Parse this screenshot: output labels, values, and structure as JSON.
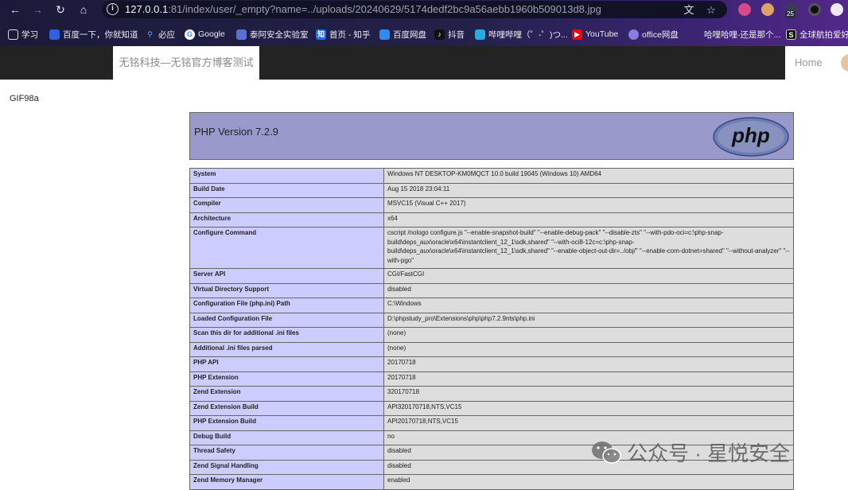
{
  "browser": {
    "url_host": "127.0.0.1",
    "url_rest": ":81/index/user/_empty?name=../uploads/20240629/5174dedf2bc9a56aebb1960b509013d8.jpg",
    "ext_badge": "25",
    "bookmarks": [
      {
        "label": "学习",
        "icon": "folder-icon"
      },
      {
        "label": "百度一下，你就知道",
        "icon": "baidu-icon"
      },
      {
        "label": "必应",
        "icon": "bing-icon"
      },
      {
        "label": "Google",
        "icon": "google-icon"
      },
      {
        "label": "泰阿安全实验室",
        "icon": "lab-icon"
      },
      {
        "label": "首页 - 知乎",
        "icon": "zhihu-icon"
      },
      {
        "label": "百度网盘",
        "icon": "netdisk-icon"
      },
      {
        "label": "抖音",
        "icon": "douyin-icon"
      },
      {
        "label": "哔哩哔哩（゜-゜)つ...",
        "icon": "bilibili-icon"
      },
      {
        "label": "YouTube",
        "icon": "youtube-icon"
      },
      {
        "label": "office网盘",
        "icon": "office-icon"
      },
      {
        "label": "哈哩哈哩-还是那个...",
        "icon": "hali-icon"
      },
      {
        "label": "全球航拍爱好者",
        "icon": "aerial-icon"
      }
    ]
  },
  "site": {
    "brand": "无铭科技—无铭官方博客测试",
    "home": "Home"
  },
  "gif_text": "GIF98a",
  "phpinfo": {
    "title": "PHP Version 7.2.9",
    "logo_text": "php",
    "rows": [
      {
        "key": "System",
        "value": "Windows NT DESKTOP-KM0MQCT 10.0 build 19045 (Windows 10) AMD64"
      },
      {
        "key": "Build Date",
        "value": "Aug 15 2018 23:04:11"
      },
      {
        "key": "Compiler",
        "value": "MSVC15 (Visual C++ 2017)"
      },
      {
        "key": "Architecture",
        "value": "x64"
      },
      {
        "key": "Configure Command",
        "value": "cscript /nologo configure.js \"--enable-snapshot-build\" \"--enable-debug-pack\" \"--disable-zts\" \"--with-pdo-oci=c:\\php-snap-build\\deps_aux\\oracle\\x64\\instantclient_12_1\\sdk,shared\" \"--with-oci8-12c=c:\\php-snap-build\\deps_aux\\oracle\\x64\\instantclient_12_1\\sdk,shared\" \"--enable-object-out-dir=../obj/\" \"--enable-com-dotnet=shared\" \"--without-analyzer\" \"--with-pgo\""
      },
      {
        "key": "Server API",
        "value": "CGI/FastCGI"
      },
      {
        "key": "Virtual Directory Support",
        "value": "disabled"
      },
      {
        "key": "Configuration File (php.ini) Path",
        "value": "C:\\Windows"
      },
      {
        "key": "Loaded Configuration File",
        "value": "D:\\phpstudy_pro\\Extensions\\php\\php7.2.9nts\\php.ini"
      },
      {
        "key": "Scan this dir for additional .ini files",
        "value": "(none)"
      },
      {
        "key": "Additional .ini files parsed",
        "value": "(none)"
      },
      {
        "key": "PHP API",
        "value": "20170718"
      },
      {
        "key": "PHP Extension",
        "value": "20170718"
      },
      {
        "key": "Zend Extension",
        "value": "320170718"
      },
      {
        "key": "Zend Extension Build",
        "value": "API320170718,NTS,VC15"
      },
      {
        "key": "PHP Extension Build",
        "value": "API20170718,NTS,VC15"
      },
      {
        "key": "Debug Build",
        "value": "no"
      },
      {
        "key": "Thread Safety",
        "value": "disabled"
      },
      {
        "key": "Zend Signal Handling",
        "value": "disabled"
      },
      {
        "key": "Zend Memory Manager",
        "value": "enabled"
      }
    ]
  },
  "watermark": "公众号 · 星悦安全",
  "colors": {
    "php_header": "#9999cc",
    "php_key_cell": "#ccccff",
    "php_value_cell": "#dddddd",
    "site_nav": "#232323"
  }
}
